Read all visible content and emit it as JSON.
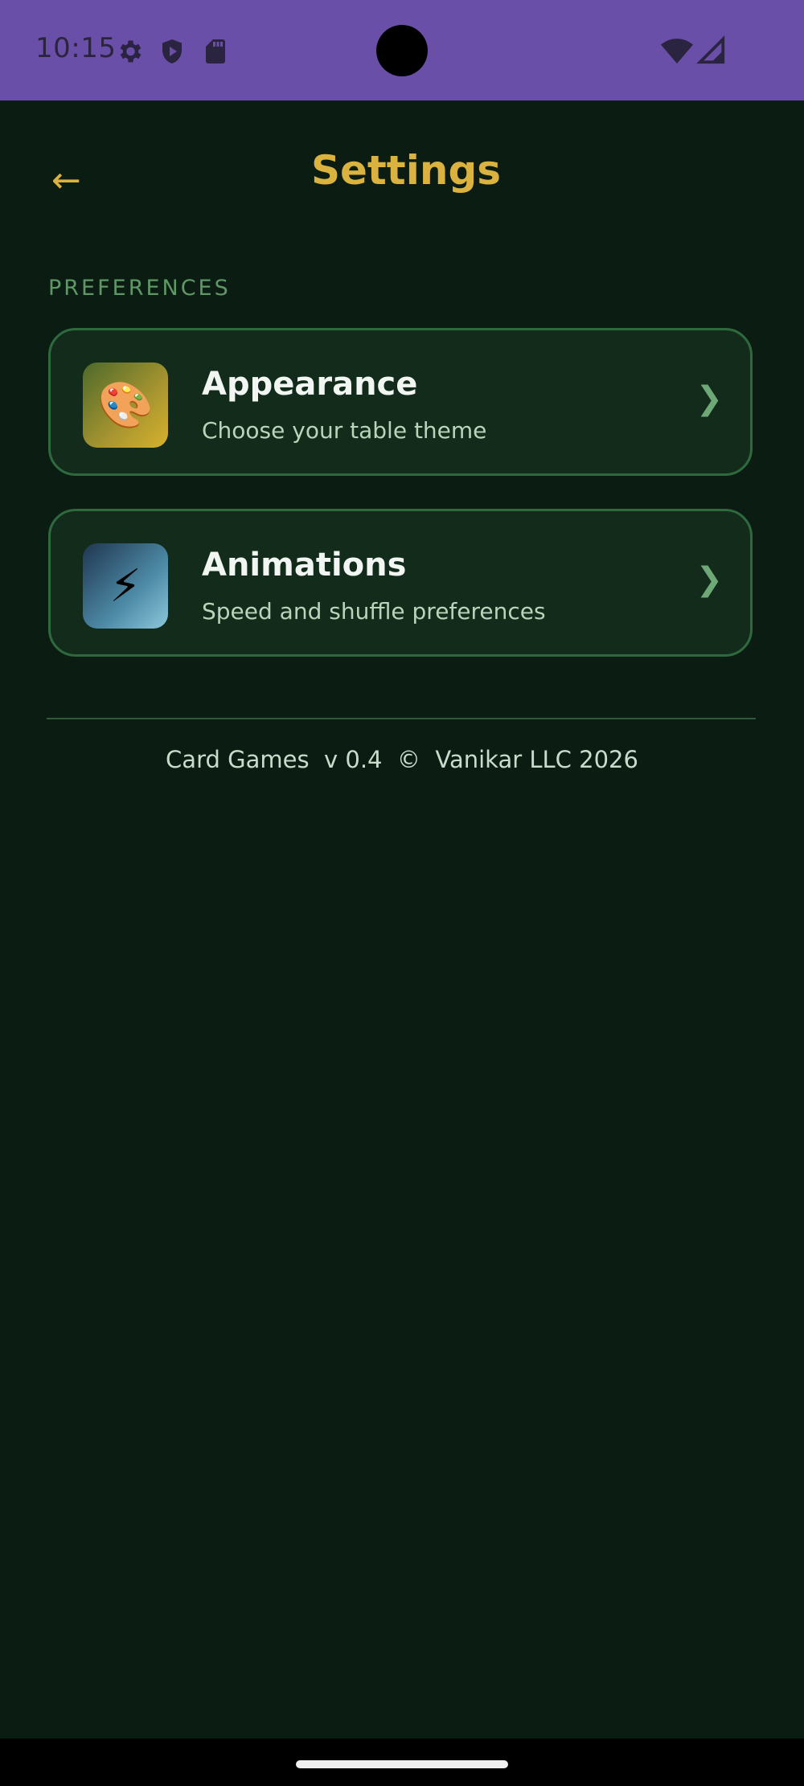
{
  "status_bar": {
    "time": "10:15",
    "left_icons": [
      "gear-icon",
      "shield-icon",
      "sd-card-icon"
    ],
    "right_icons": [
      "wifi-icon",
      "signal-icon"
    ]
  },
  "header": {
    "back_label": "←",
    "title": "Settings"
  },
  "preferences": {
    "section_label": "PREFERENCES",
    "items": [
      {
        "icon": "palette-icon",
        "emoji": "🎨",
        "title": "Appearance",
        "subtitle": "Choose your table theme",
        "chevron": "❯"
      },
      {
        "icon": "lightning-icon",
        "emoji": "⚡",
        "title": "Animations",
        "subtitle": "Speed and shuffle preferences",
        "chevron": "❯"
      }
    ]
  },
  "footer": {
    "text": "Card Games  v 0.4  ©  Vanikar LLC 2026"
  },
  "colors": {
    "status_bar": "#6a4fa8",
    "background": "#0b1c12",
    "accent_gold": "#d9b23f",
    "card_border": "#2e6a3e",
    "card_fill": "#122b1a"
  }
}
